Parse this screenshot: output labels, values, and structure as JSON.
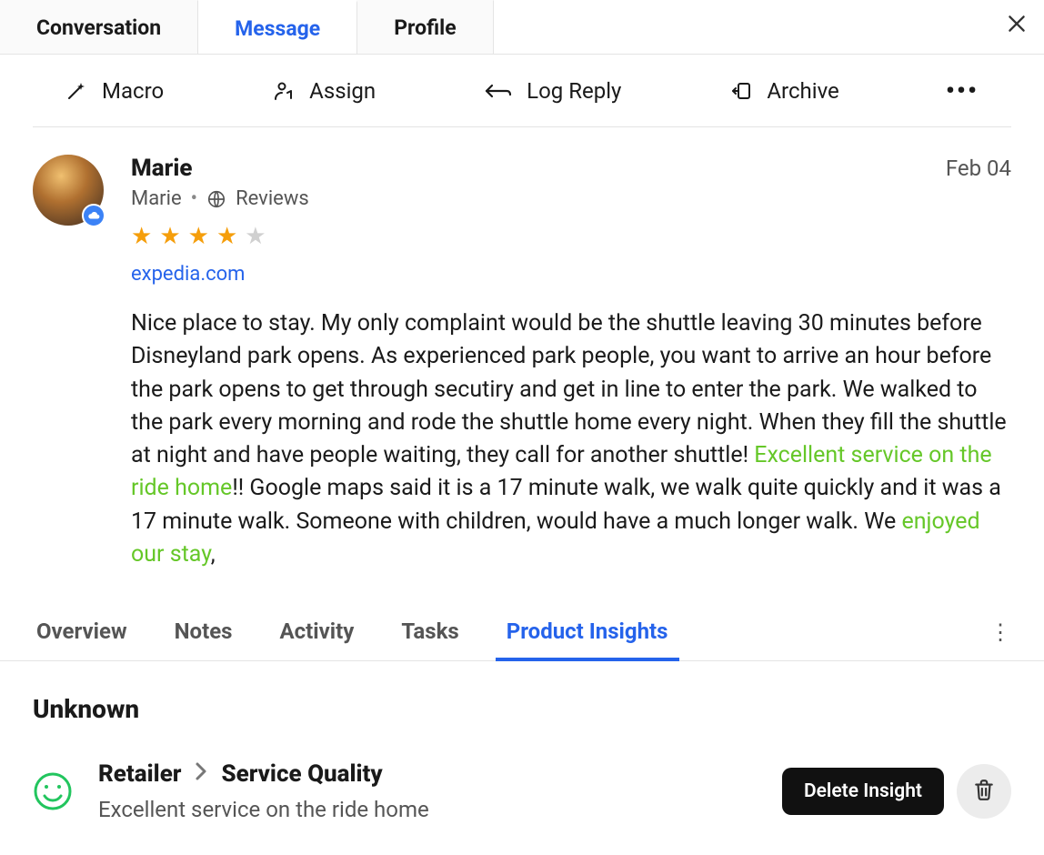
{
  "top_tabs": {
    "conversation": "Conversation",
    "message": "Message",
    "profile": "Profile",
    "active": "message"
  },
  "actions": {
    "macro": "Macro",
    "assign": "Assign",
    "log_reply": "Log Reply",
    "archive": "Archive"
  },
  "review": {
    "author": "Marie",
    "date": "Feb 04",
    "sub_author": "Marie",
    "sub_channel": "Reviews",
    "rating": 4,
    "max_rating": 5,
    "source": "expedia.com",
    "text_parts": {
      "p1": "Nice place to stay.  My only complaint would be the shuttle leaving 30 minutes before Disneyland park opens. As experienced park people, you want to arrive an hour before the park opens to get through secutiry and get in line to enter the park. We walked to the park every morning and rode the shuttle home every night.  When they fill the shuttle at night and have people waiting, they call for another shuttle!  ",
      "h1": "Excellent service on the ride home",
      "p2": "!! Google maps said it is a 17 minute walk, we walk quite quickly and it was a 17 minute walk.  Someone with children, would have a much longer walk.  We ",
      "h2": "enjoyed our stay",
      "p3": ","
    }
  },
  "lower_tabs": {
    "overview": "Overview",
    "notes": "Notes",
    "activity": "Activity",
    "tasks": "Tasks",
    "product_insights": "Product Insights",
    "active": "product_insights"
  },
  "insight": {
    "section_heading": "Unknown",
    "sentiment": "positive",
    "title_primary": "Retailer",
    "title_secondary": "Service Quality",
    "excerpt": "Excellent service on the ride home",
    "delete_label": "Delete Insight"
  },
  "icons": {
    "close": "close-icon",
    "macro": "wand-icon",
    "assign": "person-assign-icon",
    "log_reply": "reply-arrow-icon",
    "archive": "archive-icon",
    "more": "more-horizontal-icon",
    "globe": "globe-icon",
    "cloud": "cloud-download-icon",
    "smiley": "smile-icon",
    "trash": "trash-icon",
    "kebab": "more-vertical-icon",
    "chevron": "chevron-right-icon"
  }
}
